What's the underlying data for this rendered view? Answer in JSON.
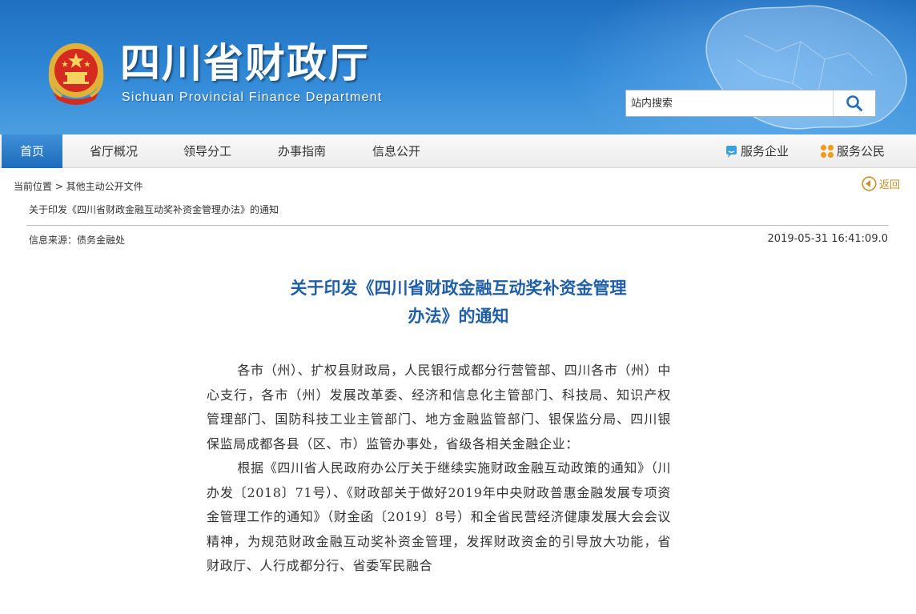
{
  "header": {
    "title": "四川省财政厅",
    "subtitle": "Sichuan Provincial Finance Department",
    "search_placeholder": "站内搜索"
  },
  "nav": {
    "items": [
      {
        "label": "首页",
        "active": true
      },
      {
        "label": "省厅概况",
        "active": false
      },
      {
        "label": "领导分工",
        "active": false
      },
      {
        "label": "办事指南",
        "active": false
      },
      {
        "label": "信息公开",
        "active": false
      }
    ],
    "right": [
      {
        "label": "服务企业",
        "icon": "chat-bubble-icon"
      },
      {
        "label": "服务公民",
        "icon": "grid-dots-icon"
      }
    ]
  },
  "breadcrumb": {
    "prefix": "当前位置 > 其他主动公开文件",
    "back_label": "返回",
    "doc_title": "关于印发《四川省财政金融互动奖补资金管理办法》的通知"
  },
  "meta": {
    "source": "信息来源：债务金融处",
    "datetime": "2019-05-31 16:41:09.0"
  },
  "article": {
    "title_line1": "关于印发《四川省财政金融互动奖补资金管理",
    "title_line2": "办法》的通知",
    "paragraphs": [
      "各市（州）、扩权县财政局，人民银行成都分行营管部、四川各市（州）中心支行，各市（州）发展改革委、经济和信息化主管部门、科技局、知识产权管理部门、国防科技工业主管部门、地方金融监管部门、银保监分局、四川银保监局成都各县（区、市）监管办事处，省级各相关金融企业：",
      "根据《四川省人民政府办公厅关于继续实施财政金融互动政策的通知》（川办发〔2018〕71号）、《财政部关于做好2019年中央财政普惠金融发展专项资金管理工作的通知》（财金函〔2019〕8号）和全省民营经济健康发展大会会议精神，为规范财政金融互动奖补资金管理，发挥财政资金的引导放大功能，省财政厅、人行成都分行、省委军民融合"
    ]
  },
  "colors": {
    "banner": "#2a7fcf",
    "nav_active": "#2a7bc8",
    "title": "#1f5fa8",
    "back": "#c8912a"
  }
}
